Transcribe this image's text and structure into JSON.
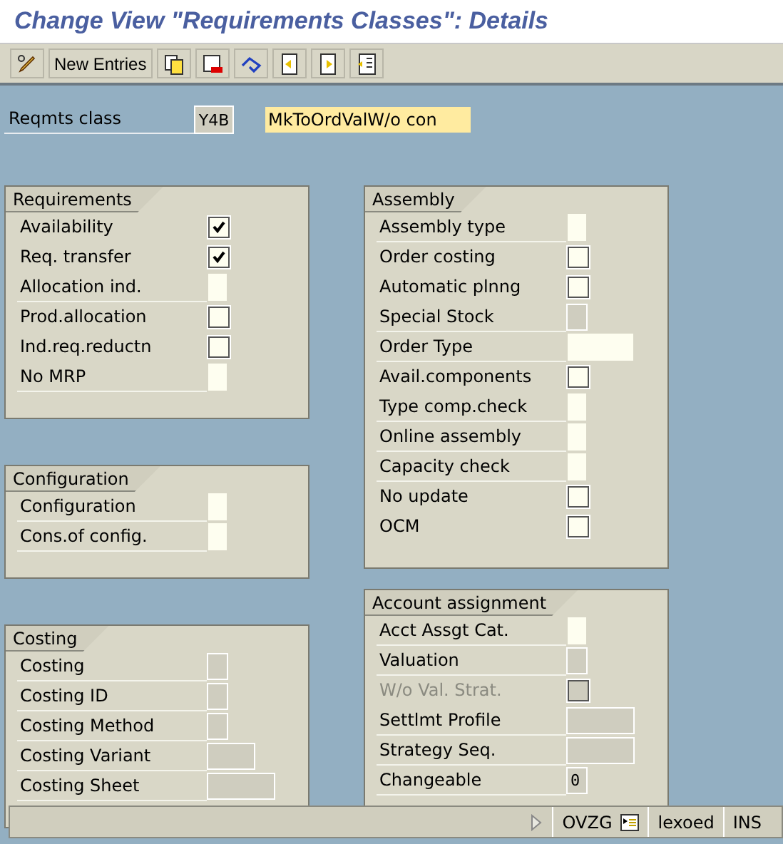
{
  "window": {
    "title": "Change View \"Requirements Classes\": Details"
  },
  "toolbar": {
    "new_entries": "New Entries"
  },
  "header": {
    "label": "Reqmts class",
    "code": "Y4B",
    "description": "MkToOrdValW/o con"
  },
  "left_panels": [
    {
      "title": "Requirements",
      "rows": [
        {
          "label": "Availability",
          "kind": "checkbox",
          "checked": true
        },
        {
          "label": "Req. transfer",
          "kind": "checkbox",
          "checked": true
        },
        {
          "label": "Allocation ind.",
          "kind": "field",
          "editable": true
        },
        {
          "label": "Prod.allocation",
          "kind": "checkbox",
          "checked": false
        },
        {
          "label": "Ind.req.reductn",
          "kind": "checkbox",
          "checked": false
        },
        {
          "label": "No MRP",
          "kind": "field",
          "editable": true
        }
      ]
    },
    {
      "title": "Configuration",
      "rows": [
        {
          "label": "Configuration",
          "kind": "field",
          "editable": true
        },
        {
          "label": "Cons.of config.",
          "kind": "field",
          "editable": true
        }
      ]
    },
    {
      "title": "Costing",
      "rows": [
        {
          "label": "Costing",
          "kind": "field",
          "editable": false
        },
        {
          "label": "Costing ID",
          "kind": "field",
          "editable": false
        },
        {
          "label": "Costing Method",
          "kind": "field",
          "editable": false
        },
        {
          "label": "Costing Variant",
          "kind": "mediumfield",
          "editable": false
        },
        {
          "label": "Costing Sheet",
          "kind": "widefield",
          "editable": false
        }
      ]
    }
  ],
  "right_panels": [
    {
      "title": "Assembly",
      "rows": [
        {
          "label": "Assembly type",
          "kind": "field",
          "editable": true
        },
        {
          "label": "Order costing",
          "kind": "checkbox",
          "checked": false
        },
        {
          "label": "Automatic plnng",
          "kind": "checkbox",
          "checked": false
        },
        {
          "label": "Special Stock",
          "kind": "field",
          "editable": false
        },
        {
          "label": "Order Type",
          "kind": "widefield",
          "editable": true
        },
        {
          "label": "Avail.components",
          "kind": "checkbox",
          "checked": false
        },
        {
          "label": "Type comp.check",
          "kind": "field",
          "editable": true
        },
        {
          "label": "Online assembly",
          "kind": "field",
          "editable": true
        },
        {
          "label": "Capacity check",
          "kind": "field",
          "editable": true
        },
        {
          "label": "No update",
          "kind": "checkbox",
          "checked": false
        },
        {
          "label": "OCM",
          "kind": "checkbox",
          "checked": false
        }
      ]
    },
    {
      "title": "Account assignment",
      "rows": [
        {
          "label": "Acct Assgt Cat.",
          "kind": "field",
          "editable": true
        },
        {
          "label": "Valuation",
          "kind": "field",
          "editable": false
        },
        {
          "label": "W/o Val. Strat.",
          "kind": "checkbox",
          "checked": false,
          "disabled": true
        },
        {
          "label": "Settlmt Profile",
          "kind": "widefield",
          "editable": false
        },
        {
          "label": "Strategy Seq.",
          "kind": "widefield",
          "editable": false
        },
        {
          "label": "Changeable",
          "kind": "field",
          "editable": false,
          "value": "0"
        }
      ]
    }
  ],
  "status_bar": {
    "transaction": "OVZG",
    "user": "lexoed",
    "mode": "INS"
  }
}
